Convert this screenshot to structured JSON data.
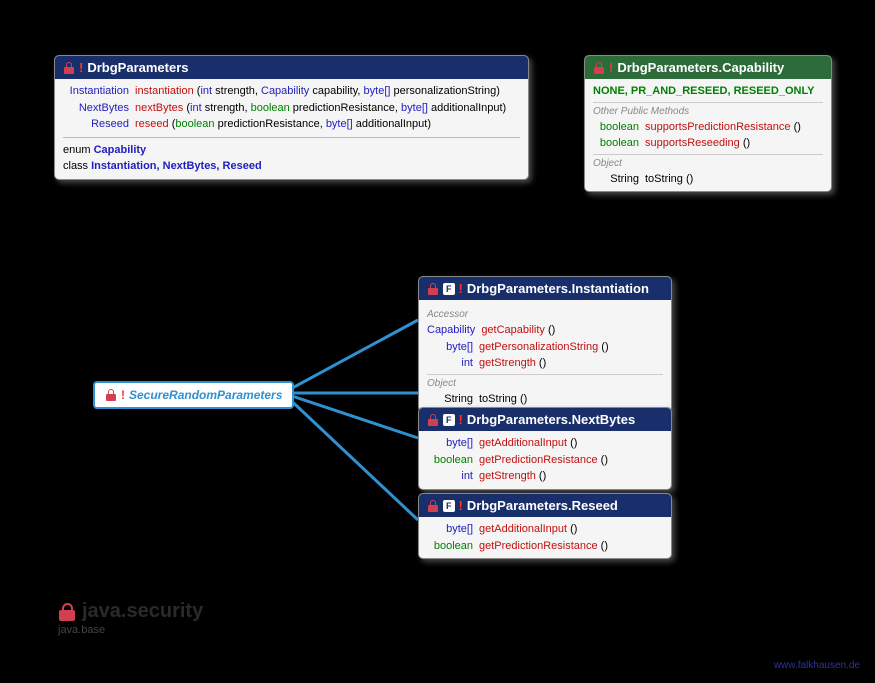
{
  "package": {
    "name": "java.security",
    "module": "java.base"
  },
  "watermark": "www.falkhausen.de",
  "iface": {
    "name": "SecureRandomParameters"
  },
  "drbg": {
    "title": "DrbgParameters",
    "m1": {
      "ret": "Instantiation",
      "name": "instantiation",
      "sig": " (int strength, Capability capability, byte[] personalizationString)"
    },
    "m2": {
      "ret": "NextBytes",
      "name": "nextBytes",
      "sig": " (int strength, boolean predictionResistance, byte[] additionalInput)"
    },
    "m3": {
      "ret": "Reseed",
      "name": "reseed",
      "sig": " (boolean predictionResistance, byte[] additionalInput)"
    },
    "enum": "Capability",
    "classes": "Instantiation, NextBytes, Reseed"
  },
  "cap": {
    "title": "DrbgParameters.Capability",
    "consts": "NONE, PR_AND_RESEED, RESEED_ONLY",
    "sec1": "Other Public Methods",
    "m1": {
      "ret": "boolean",
      "name": "supportsPredictionResistance",
      "sig": " ()"
    },
    "m2": {
      "ret": "boolean",
      "name": "supportsReseeding",
      "sig": " ()"
    },
    "sec2": "Object",
    "m3": {
      "ret": "String",
      "name": "toString",
      "sig": " ()"
    }
  },
  "inst": {
    "title": "DrbgParameters.Instantiation",
    "sec1": "Accessor",
    "m1": {
      "ret": "Capability",
      "name": "getCapability",
      "sig": " ()"
    },
    "m2": {
      "ret": "byte[]",
      "name": "getPersonalizationString",
      "sig": " ()"
    },
    "m3": {
      "ret": "int",
      "name": "getStrength",
      "sig": " ()"
    },
    "sec2": "Object",
    "m4": {
      "ret": "String",
      "name": "toString",
      "sig": " ()"
    }
  },
  "nb": {
    "title": "DrbgParameters.NextBytes",
    "m1": {
      "ret": "byte[]",
      "name": "getAdditionalInput",
      "sig": " ()"
    },
    "m2": {
      "ret": "boolean",
      "name": "getPredictionResistance",
      "sig": " ()"
    },
    "m3": {
      "ret": "int",
      "name": "getStrength",
      "sig": " ()"
    }
  },
  "rs": {
    "title": "DrbgParameters.Reseed",
    "m1": {
      "ret": "byte[]",
      "name": "getAdditionalInput",
      "sig": " ()"
    },
    "m2": {
      "ret": "boolean",
      "name": "getPredictionResistance",
      "sig": " ()"
    }
  },
  "kw": {
    "enum": "enum",
    "class": "class"
  }
}
